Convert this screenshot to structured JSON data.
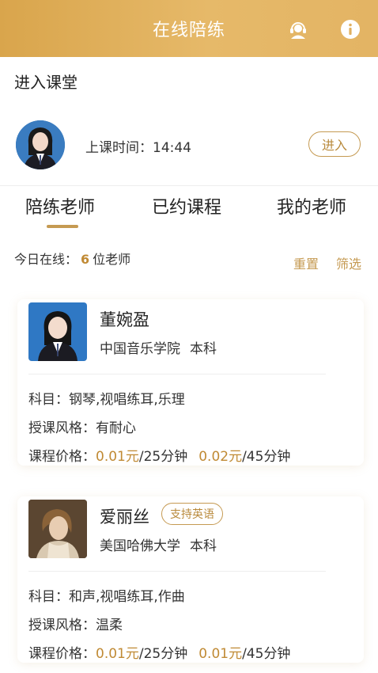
{
  "header": {
    "title": "在线陪练",
    "support_icon": "customer-service-icon",
    "info_icon": "info-icon"
  },
  "classroom": {
    "title": "进入课堂",
    "time_label": "上课时间：14:44",
    "enter_label": "进入"
  },
  "tabs": [
    {
      "label": "陪练老师",
      "active": true
    },
    {
      "label": "已约课程",
      "active": false
    },
    {
      "label": "我的老师",
      "active": false
    }
  ],
  "online": {
    "prefix": "今日在线：",
    "count": "6",
    "suffix": "位老师",
    "reset_label": "重置",
    "filter_label": "筛选"
  },
  "teachers": [
    {
      "name": "董婉盈",
      "school": "中国音乐学院",
      "degree": "本科",
      "badge": "",
      "subject_label": "科目：",
      "subjects": "钢琴,视唱练耳,乐理",
      "style_label": "授课风格：",
      "style": "有耐心",
      "price_label": "课程价格：",
      "price1": "0.01元",
      "duration1": "/25分钟",
      "price2": "0.02元",
      "duration2": "/45分钟"
    },
    {
      "name": "爱丽丝",
      "school": "美国哈佛大学",
      "degree": "本科",
      "badge": "支持英语",
      "subject_label": "科目：",
      "subjects": "和声,视唱练耳,作曲",
      "style_label": "授课风格：",
      "style": "温柔",
      "price_label": "课程价格：",
      "price1": "0.01元",
      "duration1": "/25分钟",
      "price2": "0.01元",
      "duration2": "/45分钟"
    }
  ],
  "colors": {
    "accent": "#c59a52",
    "header_start": "#d9a54c",
    "header_end": "#e3b464",
    "price": "#c08a34"
  }
}
